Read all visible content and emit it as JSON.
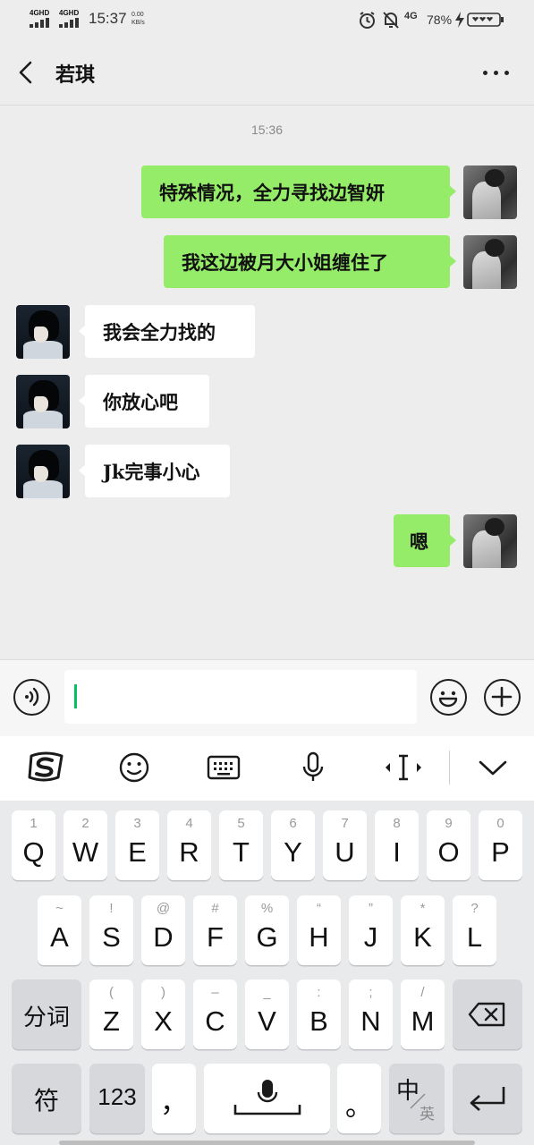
{
  "status_bar": {
    "network1": "4GHD",
    "network2": "4GHD",
    "time": "15:37",
    "speed_value": "0.00",
    "speed_unit": "KB/s",
    "network3": "4G",
    "battery": "78%"
  },
  "header": {
    "title": "若琪",
    "back_icon": "chevron-left-icon",
    "more_icon": "more-horizontal-icon"
  },
  "chat": {
    "timestamp": "15:36",
    "messages": [
      {
        "sender": "me",
        "text": "特殊情况，全力寻找边智妍"
      },
      {
        "sender": "me",
        "text": "我这边被月大小姐缠住了"
      },
      {
        "sender": "friend",
        "text": "我会全力找的"
      },
      {
        "sender": "friend",
        "text": "你放心吧"
      },
      {
        "sender": "friend",
        "text": "Jk完事小心"
      },
      {
        "sender": "me",
        "text": "嗯"
      }
    ]
  },
  "input_bar": {
    "voice_icon": "voice-icon",
    "emoji_icon": "emoji-icon",
    "plus_icon": "plus-icon",
    "value": ""
  },
  "ime_toolbar": {
    "icons": [
      "sogou-logo-icon",
      "emoji-icon",
      "keyboard-icon",
      "microphone-icon",
      "cursor-move-icon",
      "collapse-icon"
    ]
  },
  "keyboard": {
    "row1": [
      {
        "sub": "1",
        "main": "Q"
      },
      {
        "sub": "2",
        "main": "W"
      },
      {
        "sub": "3",
        "main": "E"
      },
      {
        "sub": "4",
        "main": "R"
      },
      {
        "sub": "5",
        "main": "T"
      },
      {
        "sub": "6",
        "main": "Y"
      },
      {
        "sub": "7",
        "main": "U"
      },
      {
        "sub": "8",
        "main": "I"
      },
      {
        "sub": "9",
        "main": "O"
      },
      {
        "sub": "0",
        "main": "P"
      }
    ],
    "row2": [
      {
        "sub": "~",
        "main": "A"
      },
      {
        "sub": "!",
        "main": "S"
      },
      {
        "sub": "@",
        "main": "D"
      },
      {
        "sub": "#",
        "main": "F"
      },
      {
        "sub": "%",
        "main": "G"
      },
      {
        "sub": "“",
        "main": "H"
      },
      {
        "sub": "”",
        "main": "J"
      },
      {
        "sub": "*",
        "main": "K"
      },
      {
        "sub": "?",
        "main": "L"
      }
    ],
    "row3": [
      {
        "sub": "(",
        "main": "Z"
      },
      {
        "sub": ")",
        "main": "X"
      },
      {
        "sub": "–",
        "main": "C"
      },
      {
        "sub": "_",
        "main": "V"
      },
      {
        "sub": ":",
        "main": "B"
      },
      {
        "sub": ";",
        "main": "N"
      },
      {
        "sub": "/",
        "main": "M"
      }
    ],
    "split_label": "分词",
    "symbols_label": "符",
    "numbers_label": "123",
    "comma_label": "，",
    "period_label": "。",
    "lang_main": "中",
    "lang_sub": "英"
  }
}
